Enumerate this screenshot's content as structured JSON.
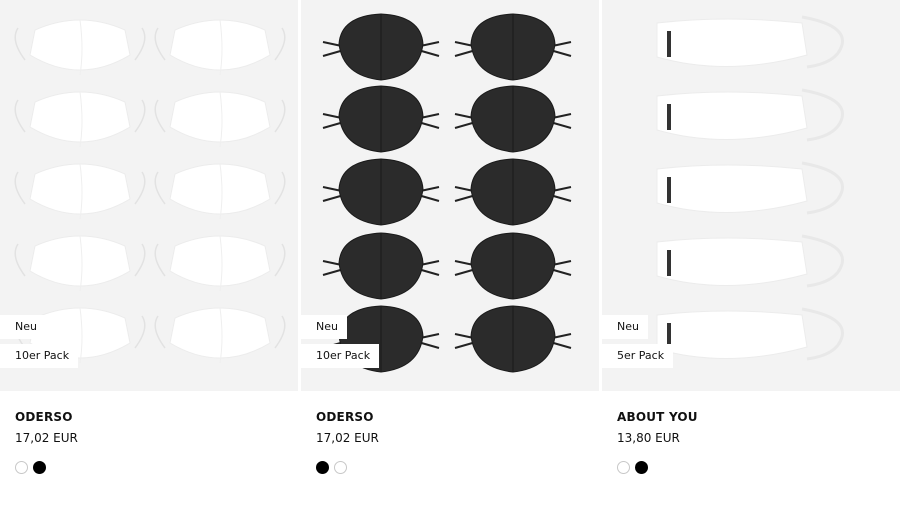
{
  "products": [
    {
      "badge_new": "Neu",
      "badge_pack": "10er Pack",
      "brand": "ODERSO",
      "price": "17,02 EUR",
      "image_icon": "white-face-masks-10-pack",
      "swatches": [
        "#ffffff",
        "#000000"
      ]
    },
    {
      "badge_new": "Neu",
      "badge_pack": "10er Pack",
      "brand": "ODERSO",
      "price": "17,02 EUR",
      "image_icon": "black-face-masks-10-pack",
      "swatches": [
        "#000000",
        "#ffffff"
      ]
    },
    {
      "badge_new": "Neu",
      "badge_pack": "5er Pack",
      "brand": "ABOUT YOU",
      "price": "13,80 EUR",
      "image_icon": "white-face-masks-5-pack",
      "swatches": [
        "#ffffff",
        "#000000"
      ]
    }
  ]
}
